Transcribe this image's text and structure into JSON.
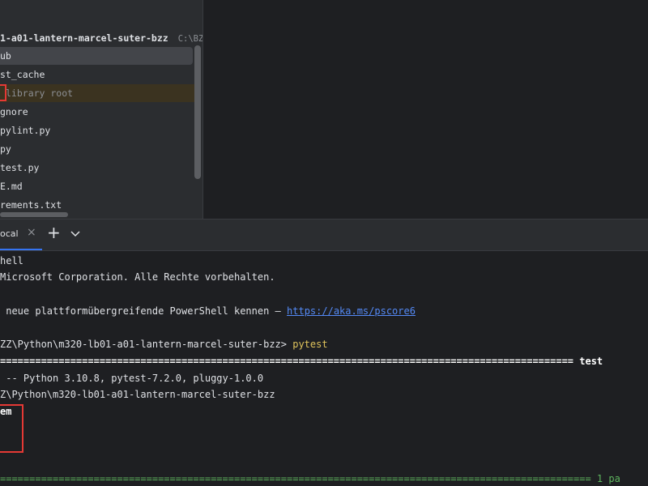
{
  "project_tree": {
    "root_name": "1-a01-lantern-marcel-suter-bzz",
    "root_path": "C:\\BZZ\\Py",
    "items": [
      {
        "label": "ub"
      },
      {
        "label": "st_cache"
      },
      {
        "label": "library root"
      },
      {
        "label": "gnore"
      },
      {
        "label": "pylint.py"
      },
      {
        "label": "py"
      },
      {
        "label": "test.py"
      },
      {
        "label": "E.md"
      },
      {
        "label": "rements.txt"
      }
    ]
  },
  "terminal": {
    "tab_label": "ocal",
    "close_glyph": "×",
    "new_tab_glyph": "+",
    "lines": {
      "l1": "hell",
      "l2": "Microsoft Corporation. Alle Rechte vorbehalten.",
      "l3_text": " neue plattformübergreifende PowerShell kennen – ",
      "l3_link": "https://aka.ms/pscore6",
      "l4_prompt": "ZZ\\Python\\m320-lb01-a01-lantern-marcel-suter-bzz> ",
      "l4_cmd": "pytest",
      "l5_rule": "==================================================================================================",
      "l5_label": " test",
      "l6": " -- Python 3.10.8, pytest-7.2.0, pluggy-1.0.0",
      "l7": "Z\\Python\\m320-lb01-a01-lantern-marcel-suter-bzz",
      "l8": "em",
      "l9_rule": "=====================================================================================================",
      "l9_label": " 1 pa"
    }
  }
}
